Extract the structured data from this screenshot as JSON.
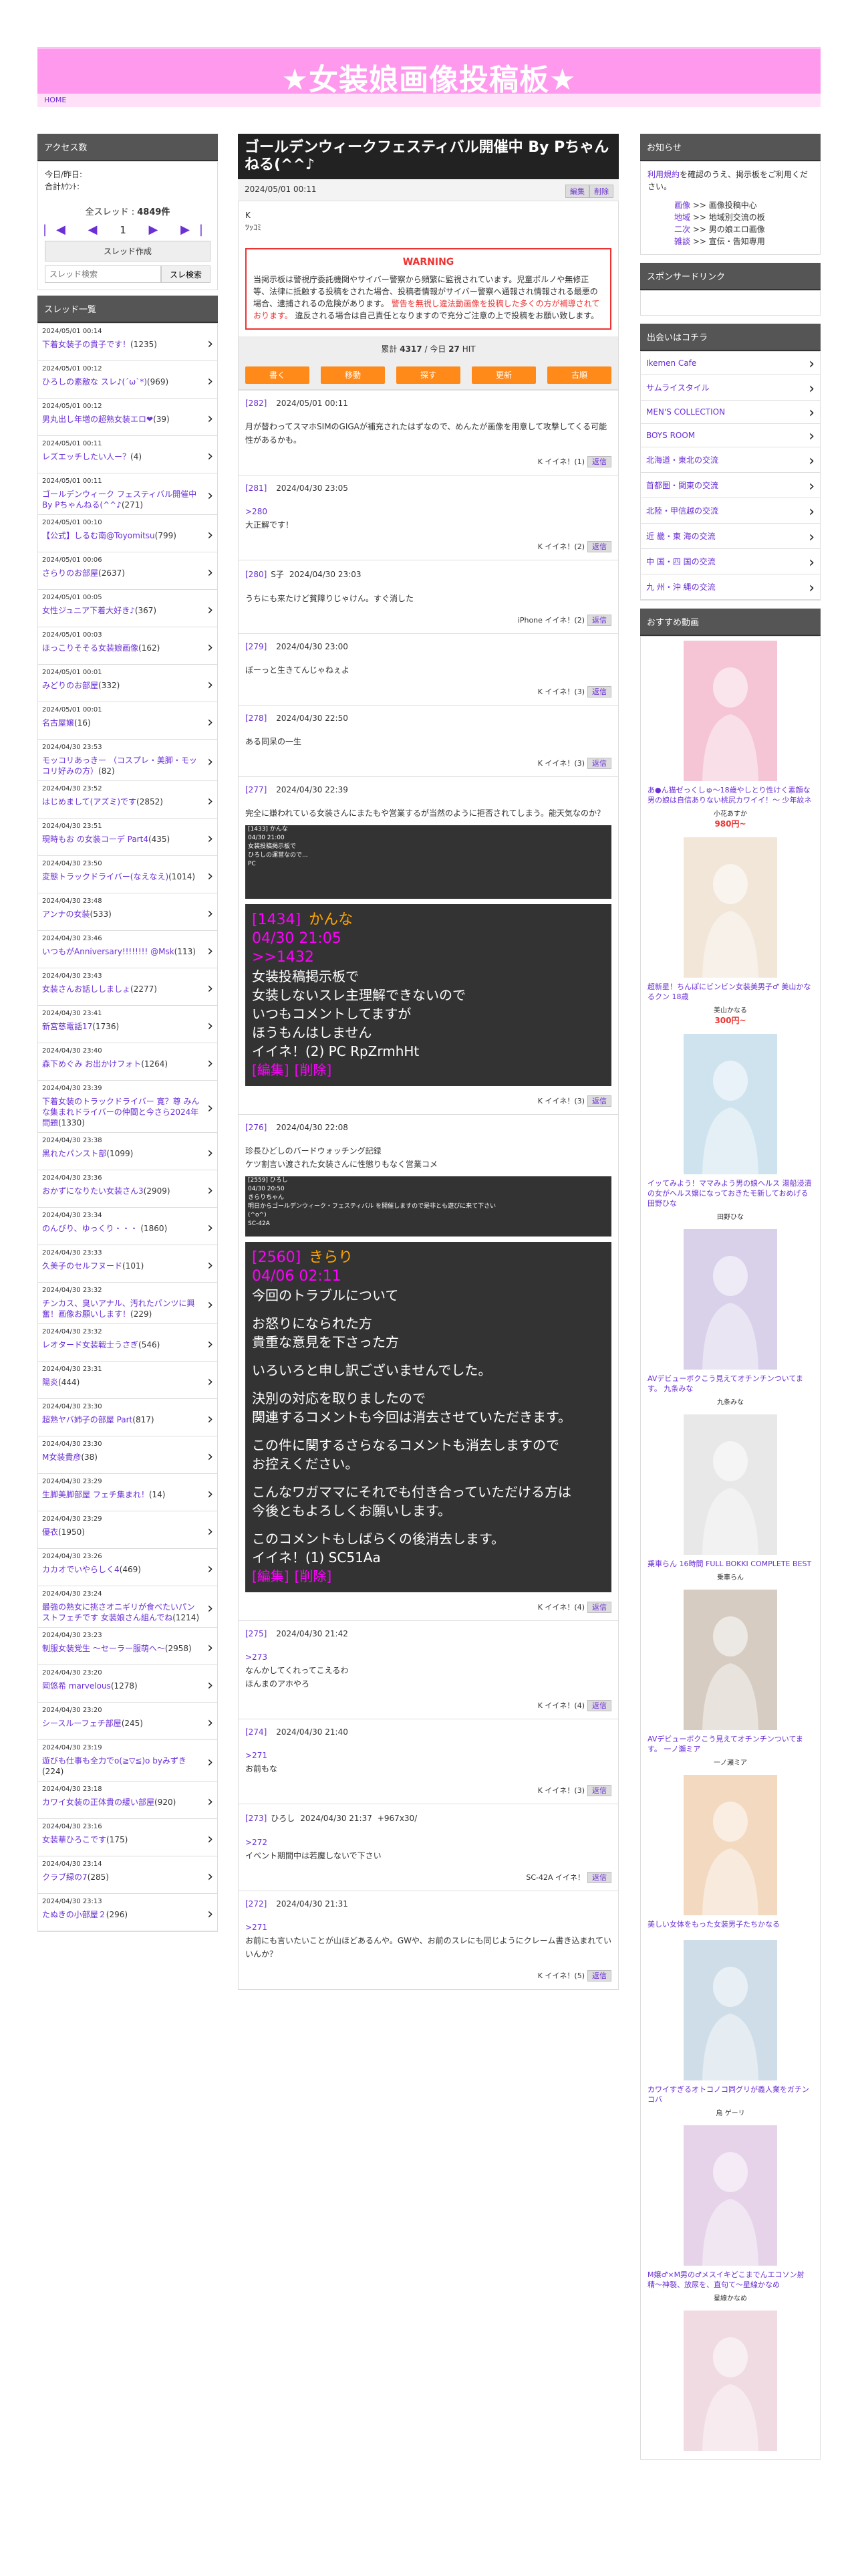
{
  "site": {
    "title": "★女装娘画像投稿板★",
    "breadcrumb": "HOME"
  },
  "left": {
    "access": {
      "header": "アクセス数",
      "today": "今日/昨日:",
      "total": "合計ｶｳﾝﾄ:",
      "all_thread_label": "全スレッド :",
      "all_thread_count": "4849件",
      "page_num": "1"
    },
    "thread_create_label": "スレッド作成",
    "search_placeholder": "スレッド検索",
    "search_button": "スレ検索",
    "thread_list_header": "スレッド一覧",
    "threads": [
      {
        "date": "2024/05/01 00:14",
        "title": "下着女装子の貴子です！",
        "count": "(1235)"
      },
      {
        "date": "2024/05/01 00:12",
        "title": "ひろしの素敵な スレ♪(´ω`*)",
        "count": "(969)"
      },
      {
        "date": "2024/05/01 00:12",
        "title": "男丸出し年増の超熟女装エロ❤",
        "count": "(39)"
      },
      {
        "date": "2024/05/01 00:11",
        "title": "レズエッチしたい人ー？",
        "count": "(4)"
      },
      {
        "date": "2024/05/01 00:11",
        "title": "ゴールデンウィーク フェスティバル開催中 By Pちゃんねる(^^♪",
        "count": "(271)"
      },
      {
        "date": "2024/05/01 00:10",
        "title": "【公式】しるむ南@Toyomitsu",
        "count": "(799)"
      },
      {
        "date": "2024/05/01 00:06",
        "title": "さらりのお部屋",
        "count": "(2637)"
      },
      {
        "date": "2024/05/01 00:05",
        "title": "女性ジュニア下着大好き♪",
        "count": "(367)"
      },
      {
        "date": "2024/05/01 00:03",
        "title": "ほっこりそそる女装娘画像",
        "count": "(162)"
      },
      {
        "date": "2024/05/01 00:01",
        "title": "みどりのお部屋",
        "count": "(332)"
      },
      {
        "date": "2024/05/01 00:01",
        "title": "名古屋嬢",
        "count": "(16)"
      },
      {
        "date": "2024/04/30 23:53",
        "title": "モッコリあっきー （コスプレ・美脚・モッコリ好みの方）",
        "count": "(82)"
      },
      {
        "date": "2024/04/30 23:52",
        "title": "はじめまして(アズミ)です",
        "count": "(2852)"
      },
      {
        "date": "2024/04/30 23:51",
        "title": "現時もお の女装コーデ Part4",
        "count": "(435)"
      },
      {
        "date": "2024/04/30 23:50",
        "title": "変態トラックドライバー(なえなえ)",
        "count": "(1014)"
      },
      {
        "date": "2024/04/30 23:48",
        "title": "アンナの女装",
        "count": "(533)"
      },
      {
        "date": "2024/04/30 23:46",
        "title": "いつもがAnniversary!!!!!!!! @Msk",
        "count": "(113)"
      },
      {
        "date": "2024/04/30 23:43",
        "title": "女装さんお話ししましょ",
        "count": "(2277)"
      },
      {
        "date": "2024/04/30 23:41",
        "title": "新宮慈電話17",
        "count": "(1736)"
      },
      {
        "date": "2024/04/30 23:40",
        "title": "森下めぐみ お出かけフォト",
        "count": "(1264)"
      },
      {
        "date": "2024/04/30 23:39",
        "title": "下着女装のトラックドライバー 寛？尊 みんな集まれドライバーの仲間と今さら2024年問題",
        "count": "(1330)"
      },
      {
        "date": "2024/04/30 23:38",
        "title": "黒れたパンスト部",
        "count": "(1099)"
      },
      {
        "date": "2024/04/30 23:36",
        "title": "おかずになりたい女装さん3",
        "count": "(2909)"
      },
      {
        "date": "2024/04/30 23:34",
        "title": "のんびり、ゆっくり・・・ ",
        "count": "(1860)"
      },
      {
        "date": "2024/04/30 23:33",
        "title": "久美子のセルフヌード",
        "count": "(101)"
      },
      {
        "date": "2024/04/30 23:32",
        "title": "チンカス、臭いアナル、汚れたパンツに興奮！画像お願いします！",
        "count": "(229)"
      },
      {
        "date": "2024/04/30 23:32",
        "title": "レオタード女装戦士うさぎ",
        "count": "(546)"
      },
      {
        "date": "2024/04/30 23:31",
        "title": "陽炎",
        "count": "(444)"
      },
      {
        "date": "2024/04/30 23:30",
        "title": "超熟ヤバ姉子の部屋 Part",
        "count": "(817)"
      },
      {
        "date": "2024/04/30 23:30",
        "title": "M女装貴彦",
        "count": "(38)"
      },
      {
        "date": "2024/04/30 23:29",
        "title": "生脚美脚部屋 フェチ集まれ！",
        "count": "(14)"
      },
      {
        "date": "2024/04/30 23:29",
        "title": "優衣",
        "count": "(1950)"
      },
      {
        "date": "2024/04/30 23:26",
        "title": "カカオでいやらしく4",
        "count": "(469)"
      },
      {
        "date": "2024/04/30 23:24",
        "title": "最強の熟女に挑さオニギリが食べたいパンストフェチです 女装娘さん組んでね",
        "count": "(1214)"
      },
      {
        "date": "2024/04/30 23:23",
        "title": "制服女装党生 〜セーラー服萌へ〜",
        "count": "(2958)"
      },
      {
        "date": "2024/04/30 23:20",
        "title": "岡悠希 marvelous",
        "count": "(1278)"
      },
      {
        "date": "2024/04/30 23:20",
        "title": "シースルーフェチ部屋",
        "count": "(245)"
      },
      {
        "date": "2024/04/30 23:19",
        "title": "遊びも仕事も全力でo(≧▽≦)o byみずき",
        "count": "(224)"
      },
      {
        "date": "2024/04/30 23:18",
        "title": "カワイ女装の正体貴の緩い部屋",
        "count": "(920)"
      },
      {
        "date": "2024/04/30 23:16",
        "title": "女装華ひろこです",
        "count": "(175)"
      },
      {
        "date": "2024/04/30 23:14",
        "title": "クラブ緑の7",
        "count": "(285)"
      },
      {
        "date": "2024/04/30 23:13",
        "title": "たぬきの小部屋２",
        "count": "(296)"
      }
    ]
  },
  "main": {
    "title": "ゴールデンウィークフェスティバル開催中 By Pちゃんねる(^^♪",
    "meta_date": "2024/05/01 00:11",
    "edit_label": "編集",
    "delete_label": "削除",
    "op_line1": "K",
    "op_line2": "ﾂｯｺﾐ",
    "warning_title": "WARNING",
    "warning_body": "当掲示板は警視庁委託機関やサイバー警察から頻繁に監視されています。児童ポルノや無修正等、法律に抵触する投稿をされた場合、投稿者情報がサイバー警察へ通報され情報される最悪の場合、逮捕されるの危険があります。",
    "warning_red": "警告を無視し違法動画像を投稿した多くの方が補導されております。",
    "warning_tail": "違反される場合は自己責任となりますので充分ご注意の上で投稿をお願い致します。",
    "count_label": "累計",
    "count_total": "4317",
    "count_today_label": "/ 今日",
    "count_today": "27",
    "count_hit": "HIT",
    "actions": [
      "書く",
      "移動",
      "探す",
      "更新",
      "古順"
    ],
    "posts": [
      {
        "num": "[282]",
        "name": "",
        "date": "2024/05/01 00:11",
        "lines": [
          "月が替わってスマホSIMのGIGAが補充されたはずなので、めんたが画像を用意して攻撃してくる可能性があるかも。"
        ],
        "foot": "K イイネ！(1)",
        "reply": "返信"
      },
      {
        "num": "[281]",
        "name": "",
        "date": "2024/04/30 23:05",
        "link": ">280",
        "lines": [
          "大正解です！"
        ],
        "foot": "K イイネ！(2)",
        "reply": "返信"
      },
      {
        "num": "[280]",
        "name": "S子",
        "date": "2024/04/30 23:03",
        "lines": [
          "うちにも来たけど貧障りじゃけん。すぐ消した"
        ],
        "foot": "iPhone イイネ！(2)",
        "reply": "返信"
      },
      {
        "num": "[279]",
        "name": "",
        "date": "2024/04/30 23:00",
        "lines": [
          "ぼーっと生きてんじゃねぇよ"
        ],
        "foot": "K イイネ！(3)",
        "reply": "返信"
      },
      {
        "num": "[278]",
        "name": "",
        "date": "2024/04/30 22:50",
        "lines": [
          "ある同呆の一生"
        ],
        "foot": "K イイネ！(3)",
        "reply": "返信"
      },
      {
        "num": "[277]",
        "name": "",
        "date": "2024/04/30 22:39",
        "lines": [
          "完全に嫌われている女装さんにまたもや営業するが当然のように拒否されてしまう。能天気なのか？"
        ],
        "foot": "K イイネ！(3)",
        "reply": "返信"
      },
      {
        "num": "[276]",
        "name": "",
        "date": "2024/04/30 22:08",
        "lines": [
          "珍長ひどしのバードウォッチング記録",
          "ケツ割言い渡された女装さんに性懲りもなく営業コメ"
        ],
        "foot": "K イイネ！(4)",
        "reply": "返信"
      },
      {
        "num": "[275]",
        "name": "",
        "date": "2024/04/30 21:42",
        "link": ">273",
        "lines": [
          "なんかしてくれってこえるわ",
          "ほんまのアホやろ"
        ],
        "foot": "K イイネ！(4)",
        "reply": "返信"
      },
      {
        "num": "[274]",
        "name": "",
        "date": "2024/04/30 21:40",
        "link": ">271",
        "lines": [
          "お前もな"
        ],
        "foot": "K イイネ！(3)",
        "reply": "返信"
      },
      {
        "num": "[273]",
        "name": "ひろし",
        "date": "2024/04/30 21:37",
        "extra": "+967x30/",
        "link": ">272",
        "lines": [
          "イベント期間中は若魔しないで下さい"
        ],
        "foot": "SC-42A イイネ！",
        "reply": "返信"
      },
      {
        "num": "[272]",
        "name": "",
        "date": "2024/04/30 21:31",
        "link": ">271",
        "lines": [
          "お前にも言いたいことが山ほどあるんや。GWや、お前のスレにも同じようにクレーム書き込まれていいんか？"
        ],
        "foot": "K イイネ！(5)",
        "reply": "返信"
      }
    ],
    "screenshot1": {
      "lines": [
        "[1433] かんな",
        "04/30 21:00",
        "女装投稿掲示板で",
        "ひろしの運営なので...",
        "PC"
      ],
      "big_name": "かんな",
      "big_num": "[1434]",
      "big_date": "04/30 21:05",
      "big_link": ">>1432",
      "big_lines": [
        "女装投稿掲示板で",
        "女装しないスレ主理解できないので",
        "いつもコメントしてますが",
        "ほうもんはしません"
      ],
      "big_foot": "イイネ！(2)   PC  RpZrmhHt",
      "big_edit": "[編集]",
      "big_del": "[削除]"
    },
    "screenshot2": {
      "lines": [
        "[2559] ひろし",
        "04/30 20:50",
        "きらりちゃん",
        "明日からゴールデンウィーク・フェスティバル を開催しますので是非とも遊びに来て下さい",
        "(^o^)",
        "SC-42A"
      ],
      "big_num": "[2560]",
      "big_name": "きらり",
      "big_date": "04/06 02:11",
      "big_lines": [
        "今回のトラブルについて",
        "",
        "お怒りになられた方",
        "貴重な意見を下さった方",
        "",
        "いろいろと申し訳ございませんでした。",
        "",
        "決別の対応を取りましたので",
        "関連するコメントも今回は消去させていただきます。",
        "",
        "この件に関するさらなるコメントも消去しますので",
        "お控えください。",
        "",
        "こんなワガママにそれでも付き合っていただける方は",
        "今後ともよろしくお願いします。",
        "",
        "このコメントもしばらくの後消去します。"
      ],
      "big_foot": "イイネ！(1)  SC51Aa",
      "big_edit": "[編集]",
      "big_del": "[削除]"
    }
  },
  "right": {
    "notice_header": "お知らせ",
    "notice_link": "利用規約",
    "notice_text": "を確認のうえ、掲示板をご利用ください。",
    "guide": [
      {
        "k": "画像",
        "v": " >> 画像投稿中心"
      },
      {
        "k": "地域",
        "v": " >> 地域別交流の板"
      },
      {
        "k": "二次",
        "v": " >> 男の娘エロ画像"
      },
      {
        "k": "雑談",
        "v": " >> 宣伝・告知専用"
      }
    ],
    "sponsor_header": "スポンサードリンク",
    "dating_header": "出会いはコチラ",
    "dating": [
      "Ikemen Cafe",
      "サムライスタイル",
      "MEN'S COLLECTION",
      "BOYS ROOM",
      "北海道・東北の交流",
      "首都圏・関東の交流",
      "北陸・甲信越の交流",
      "近 畿・東 海の交流",
      "中 国・四 国の交流",
      "九 州・沖 縄の交流"
    ],
    "rec_header": "おすすめ動画",
    "recs": [
      {
        "cap": "あ●ん猫ゼっくしゅ〜18歳やしとり性けく素顔な男の娘は自信ありない桃尻カワイイ！〜 少年紋ネ",
        "actor": "小花あすか",
        "price": "980円~",
        "color": "#f5c5d6"
      },
      {
        "cap": "超新星！ちんぽにビンビン女装美男子♂ 美山かなるクン 18歳",
        "actor": "美山かなる",
        "price": "300円~",
        "color": "#f2e6d8"
      },
      {
        "cap": "イッてみよう！ママみよう男の娘ヘルス 湯船浸漬の女がヘルス嬢になっておきたモ新しておめげる 田野ひな",
        "actor": "田野ひな",
        "price": "",
        "color": "#cfe3ef"
      },
      {
        "cap": "AVデビューボクこう見えてオチンチンついてます。 九条みな",
        "actor": "九条みな",
        "price": "",
        "color": "#d9d0ea"
      },
      {
        "cap": "乗車らん 16時間 FULL BOKKI COMPLETE BEST",
        "actor": "乗車らん",
        "price": "",
        "color": "#e8e8e8"
      },
      {
        "cap": "AVデビューボクこう見えてオチンチンついてます。 一ノ瀬ミア",
        "actor": "一ノ瀬ミア",
        "price": "",
        "color": "#d6ccc2"
      },
      {
        "cap": "美しい女体をもった女装男子たちかなる",
        "actor": "",
        "price": "",
        "color": "#f3d9c0"
      },
      {
        "cap": "カワイすぎるオトコノコ同グリが義人業をガチンコバ",
        "actor": "鳥 ゲーリ",
        "price": "",
        "color": "#cfdde8"
      },
      {
        "cap": "M嬢♂×M男の♂メスイキどこまでんエコソン射精〜神裂、放尿を、直句て〜星線かなめ",
        "actor": "星線かなめ",
        "price": "",
        "color": "#e6d3ea"
      },
      {
        "cap": "",
        "actor": "",
        "price": "",
        "color": "#f0dbe2"
      }
    ]
  }
}
